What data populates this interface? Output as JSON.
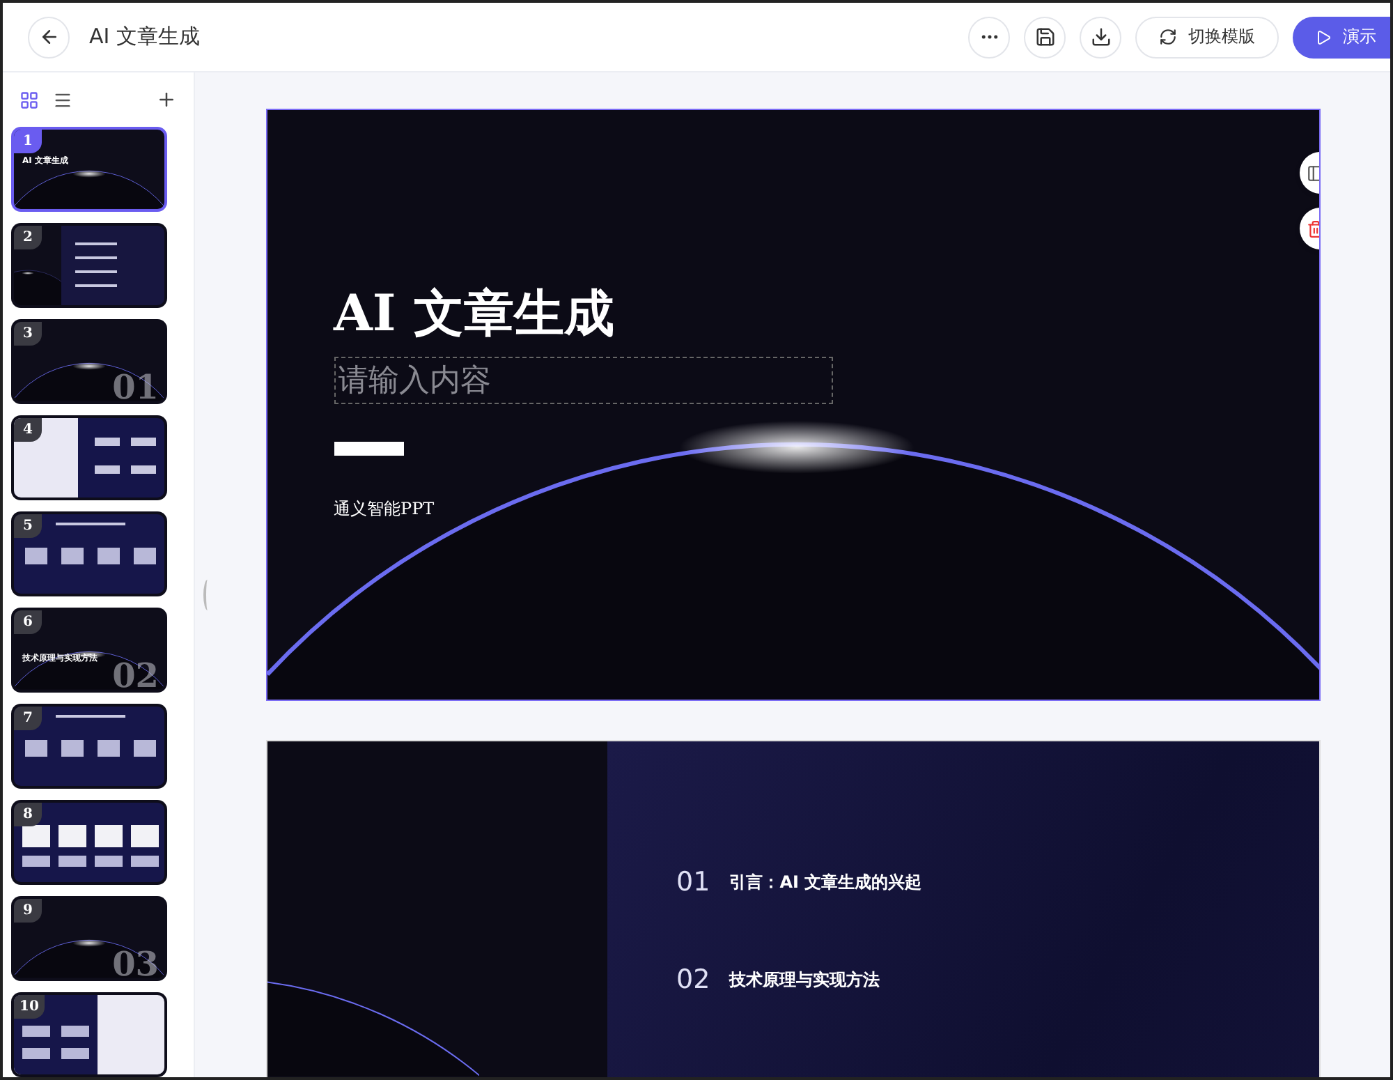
{
  "header": {
    "title": "AI 文章生成",
    "icon_buttons": [
      {
        "kind": "more"
      },
      {
        "kind": "save"
      },
      {
        "kind": "download"
      }
    ],
    "template_button": "切换模版",
    "present_button": "演示"
  },
  "sidebar": {
    "view_modes": [
      {
        "kind": "grid",
        "selected": true
      },
      {
        "kind": "list",
        "selected": false
      }
    ],
    "thumbnails": [
      {
        "number": "1",
        "selected": true,
        "kind": "cover",
        "title": "AI 文章生成"
      },
      {
        "number": "2",
        "selected": false,
        "kind": "agenda"
      },
      {
        "number": "3",
        "selected": false,
        "kind": "section",
        "big_number": "01"
      },
      {
        "number": "4",
        "selected": false,
        "kind": "light-split"
      },
      {
        "number": "5",
        "selected": false,
        "kind": "navy"
      },
      {
        "number": "6",
        "selected": false,
        "kind": "section",
        "title": "技术原理与实现方法",
        "big_number": "02"
      },
      {
        "number": "7",
        "selected": false,
        "kind": "navy"
      },
      {
        "number": "8",
        "selected": false,
        "kind": "cards"
      },
      {
        "number": "9",
        "selected": false,
        "kind": "section",
        "big_number": "03"
      },
      {
        "number": "10",
        "selected": false,
        "kind": "navy-light"
      }
    ]
  },
  "slides": [
    {
      "kind": "cover",
      "selected": true,
      "title": "AI 文章生成",
      "placeholder": "请输入内容",
      "subtitle": "通义智能PPT"
    },
    {
      "kind": "agenda",
      "selected": false,
      "items": [
        {
          "number": "01",
          "text": "引言：AI 文章生成的兴起"
        },
        {
          "number": "02",
          "text": "技术原理与实现方法"
        }
      ]
    }
  ]
}
